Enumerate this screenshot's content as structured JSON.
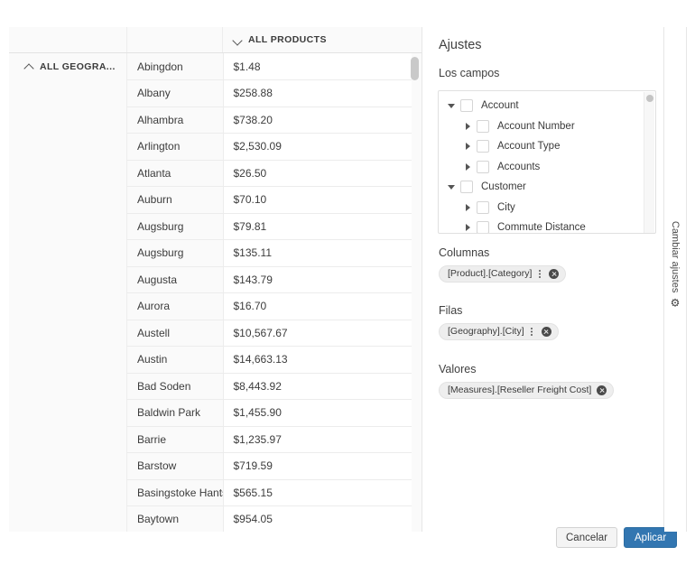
{
  "pivot": {
    "corner_empty": "",
    "column_header": {
      "label": "ALL PRODUCTS",
      "chevron": "chevron-down-icon"
    },
    "row_header": {
      "label": "ALL GEOGRA...",
      "chevron": "chevron-up-icon"
    },
    "rows": [
      {
        "city": "Abingdon",
        "value": "$1.48"
      },
      {
        "city": "Albany",
        "value": "$258.88"
      },
      {
        "city": "Alhambra",
        "value": "$738.20"
      },
      {
        "city": "Arlington",
        "value": "$2,530.09"
      },
      {
        "city": "Atlanta",
        "value": "$26.50"
      },
      {
        "city": "Auburn",
        "value": "$70.10"
      },
      {
        "city": "Augsburg",
        "value": "$79.81"
      },
      {
        "city": "Augsburg",
        "value": "$135.11"
      },
      {
        "city": "Augusta",
        "value": "$143.79"
      },
      {
        "city": "Aurora",
        "value": "$16.70"
      },
      {
        "city": "Austell",
        "value": "$10,567.67"
      },
      {
        "city": "Austin",
        "value": "$14,663.13"
      },
      {
        "city": "Bad Soden",
        "value": "$8,443.92"
      },
      {
        "city": "Baldwin Park",
        "value": "$1,455.90"
      },
      {
        "city": "Barrie",
        "value": "$1,235.97"
      },
      {
        "city": "Barstow",
        "value": "$719.59"
      },
      {
        "city": "Basingstoke Hants",
        "value": "$565.15"
      },
      {
        "city": "Baytown",
        "value": "$954.05"
      }
    ]
  },
  "settings": {
    "title": "Ajustes",
    "fields_label": "Los campos",
    "tree": [
      {
        "label": "Account",
        "level": 1,
        "toggle": "triangle-down-icon"
      },
      {
        "label": "Account Number",
        "level": 2,
        "toggle": "triangle-right-icon"
      },
      {
        "label": "Account Type",
        "level": 2,
        "toggle": "triangle-right-icon"
      },
      {
        "label": "Accounts",
        "level": 2,
        "toggle": "triangle-right-icon"
      },
      {
        "label": "Customer",
        "level": 1,
        "toggle": "triangle-down-icon"
      },
      {
        "label": "City",
        "level": 2,
        "toggle": "triangle-right-icon"
      },
      {
        "label": "Commute Distance",
        "level": 2,
        "toggle": "triangle-right-icon"
      }
    ],
    "zones": [
      {
        "label": "Columnas",
        "chip": "[Product].[Category]",
        "has_handle": true
      },
      {
        "label": "Filas",
        "chip": "[Geography].[City]",
        "has_handle": true
      },
      {
        "label": "Valores",
        "chip": "[Measures].[Reseller Freight Cost]",
        "has_handle": false
      }
    ],
    "cancel_label": "Cancelar",
    "apply_label": "Aplicar",
    "apply_color": "#3276b1"
  },
  "vertical_tab": {
    "label": "Cambiar ajustes",
    "icon": "gear-icon",
    "glyph": "⚙"
  }
}
